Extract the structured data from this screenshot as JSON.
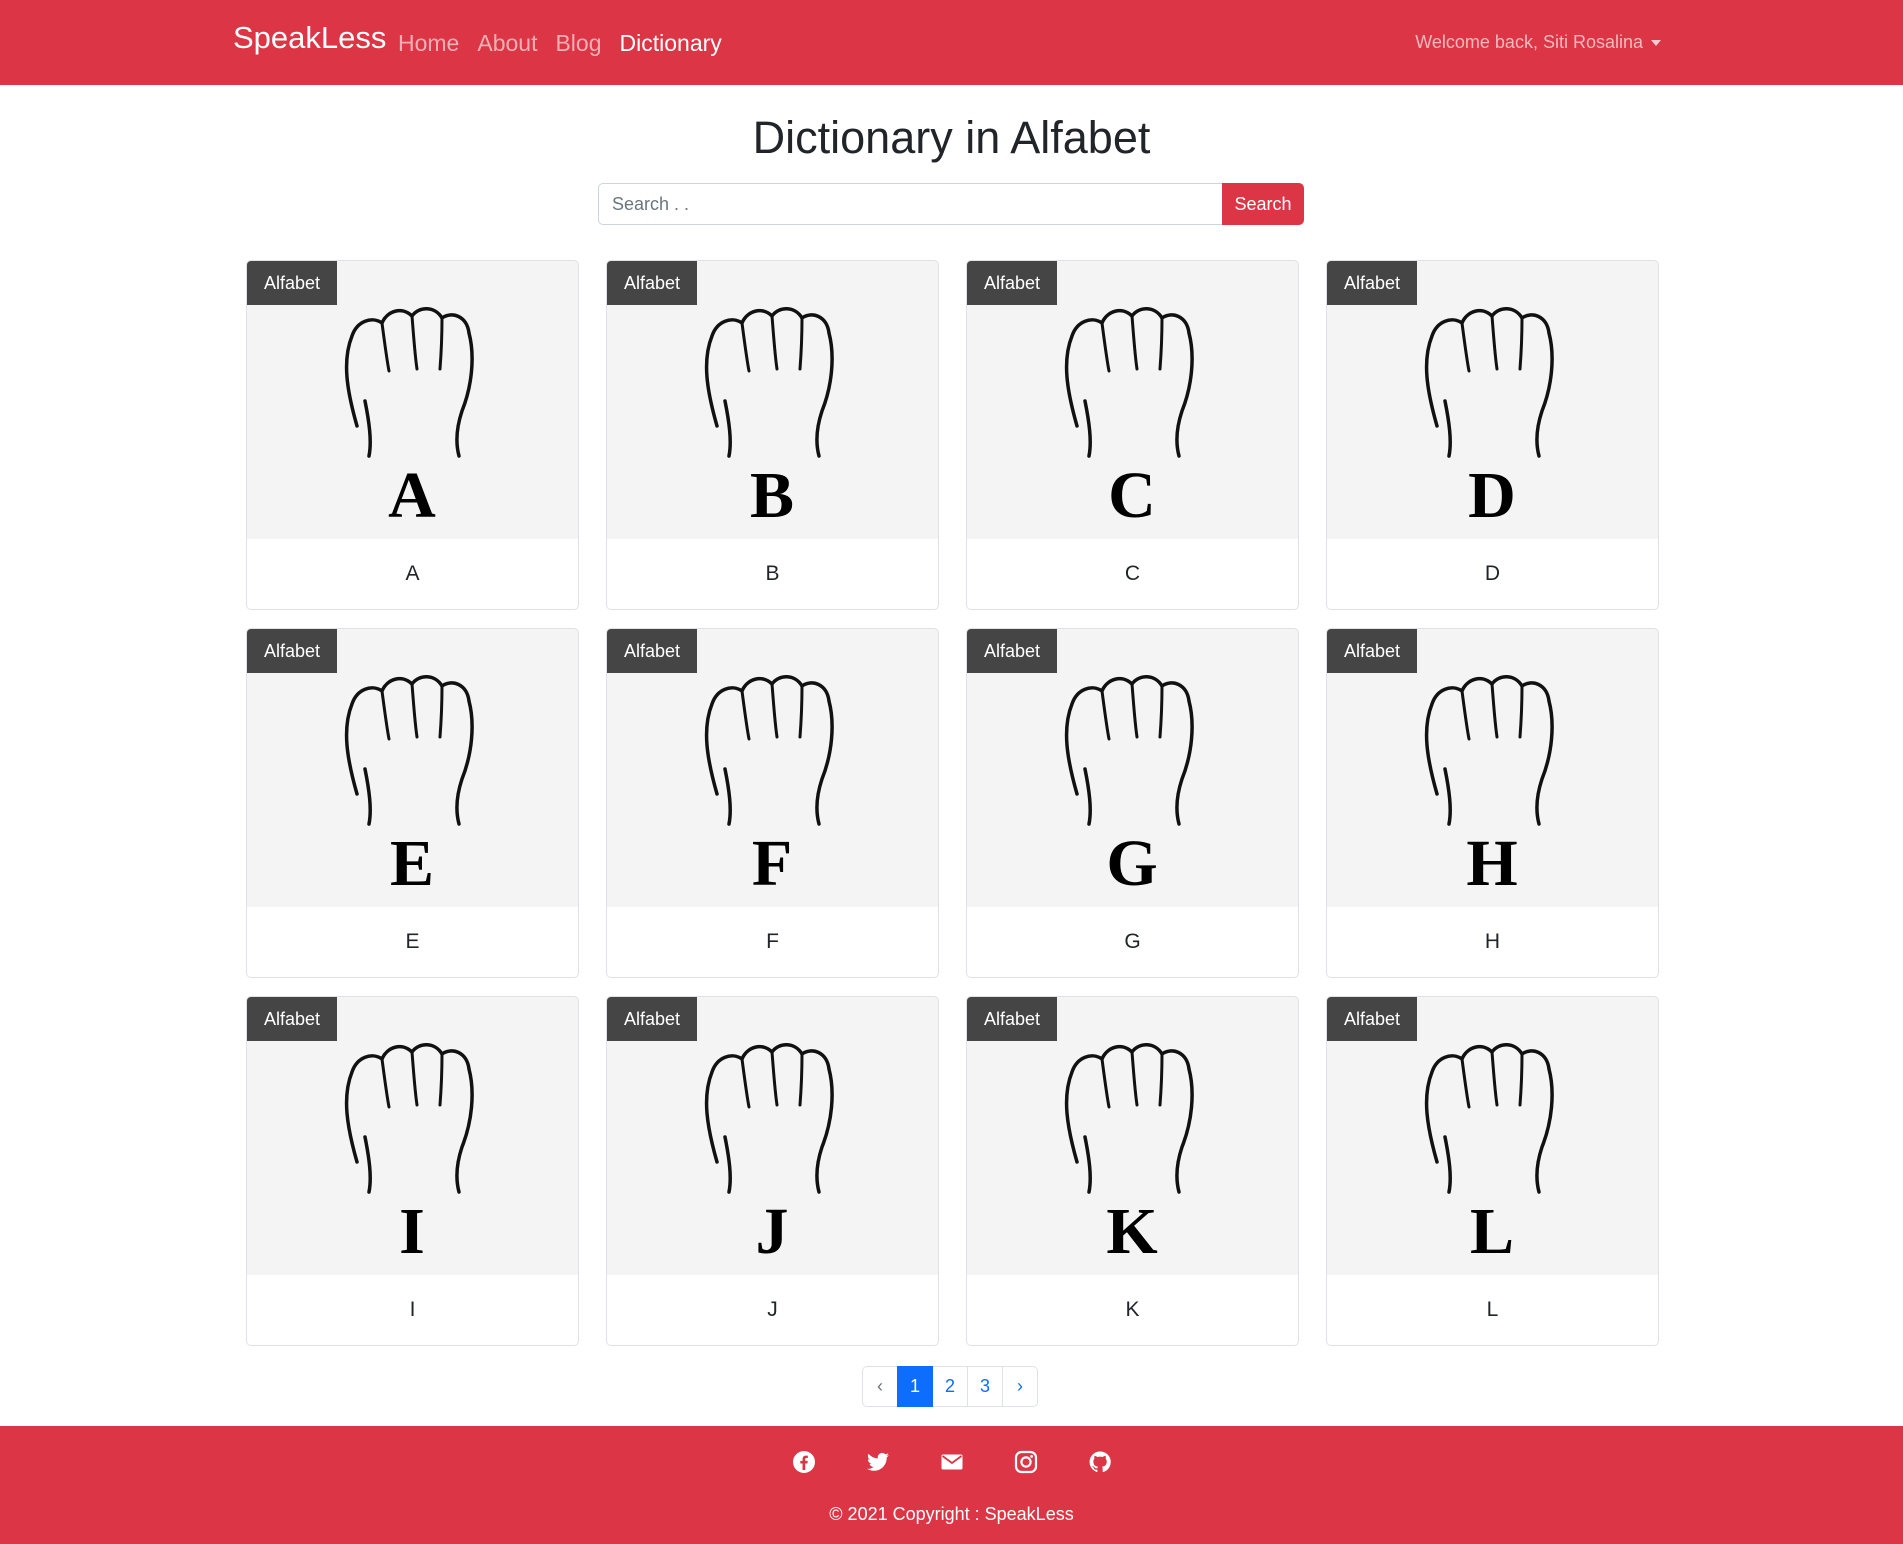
{
  "navbar": {
    "brand": "SpeakLess",
    "links": [
      "Home",
      "About",
      "Blog",
      "Dictionary"
    ],
    "active_link": "Dictionary",
    "user_greeting": "Welcome back, Siti Rosalina"
  },
  "page": {
    "title": "Dictionary in Alfabet"
  },
  "search": {
    "placeholder": "Search . .",
    "button_label": "Search"
  },
  "cards": [
    {
      "badge": "Alfabet",
      "letter": "A",
      "label": "A"
    },
    {
      "badge": "Alfabet",
      "letter": "B",
      "label": "B"
    },
    {
      "badge": "Alfabet",
      "letter": "C",
      "label": "C"
    },
    {
      "badge": "Alfabet",
      "letter": "D",
      "label": "D"
    },
    {
      "badge": "Alfabet",
      "letter": "E",
      "label": "E"
    },
    {
      "badge": "Alfabet",
      "letter": "F",
      "label": "F"
    },
    {
      "badge": "Alfabet",
      "letter": "G",
      "label": "G"
    },
    {
      "badge": "Alfabet",
      "letter": "H",
      "label": "H"
    },
    {
      "badge": "Alfabet",
      "letter": "I",
      "label": "I"
    },
    {
      "badge": "Alfabet",
      "letter": "J",
      "label": "J"
    },
    {
      "badge": "Alfabet",
      "letter": "K",
      "label": "K"
    },
    {
      "badge": "Alfabet",
      "letter": "L",
      "label": "L"
    }
  ],
  "pagination": {
    "prev": "‹",
    "pages": [
      "1",
      "2",
      "3"
    ],
    "active_page": "1",
    "next": "›"
  },
  "footer": {
    "social_icons": [
      "facebook-icon",
      "twitter-icon",
      "email-icon",
      "instagram-icon",
      "github-icon"
    ],
    "copyright": "© 2021 Copyright : SpeakLess"
  },
  "colors": {
    "primary": "#dc3545",
    "pagination_active": "#0d6efd",
    "badge_bg": "#333333"
  }
}
